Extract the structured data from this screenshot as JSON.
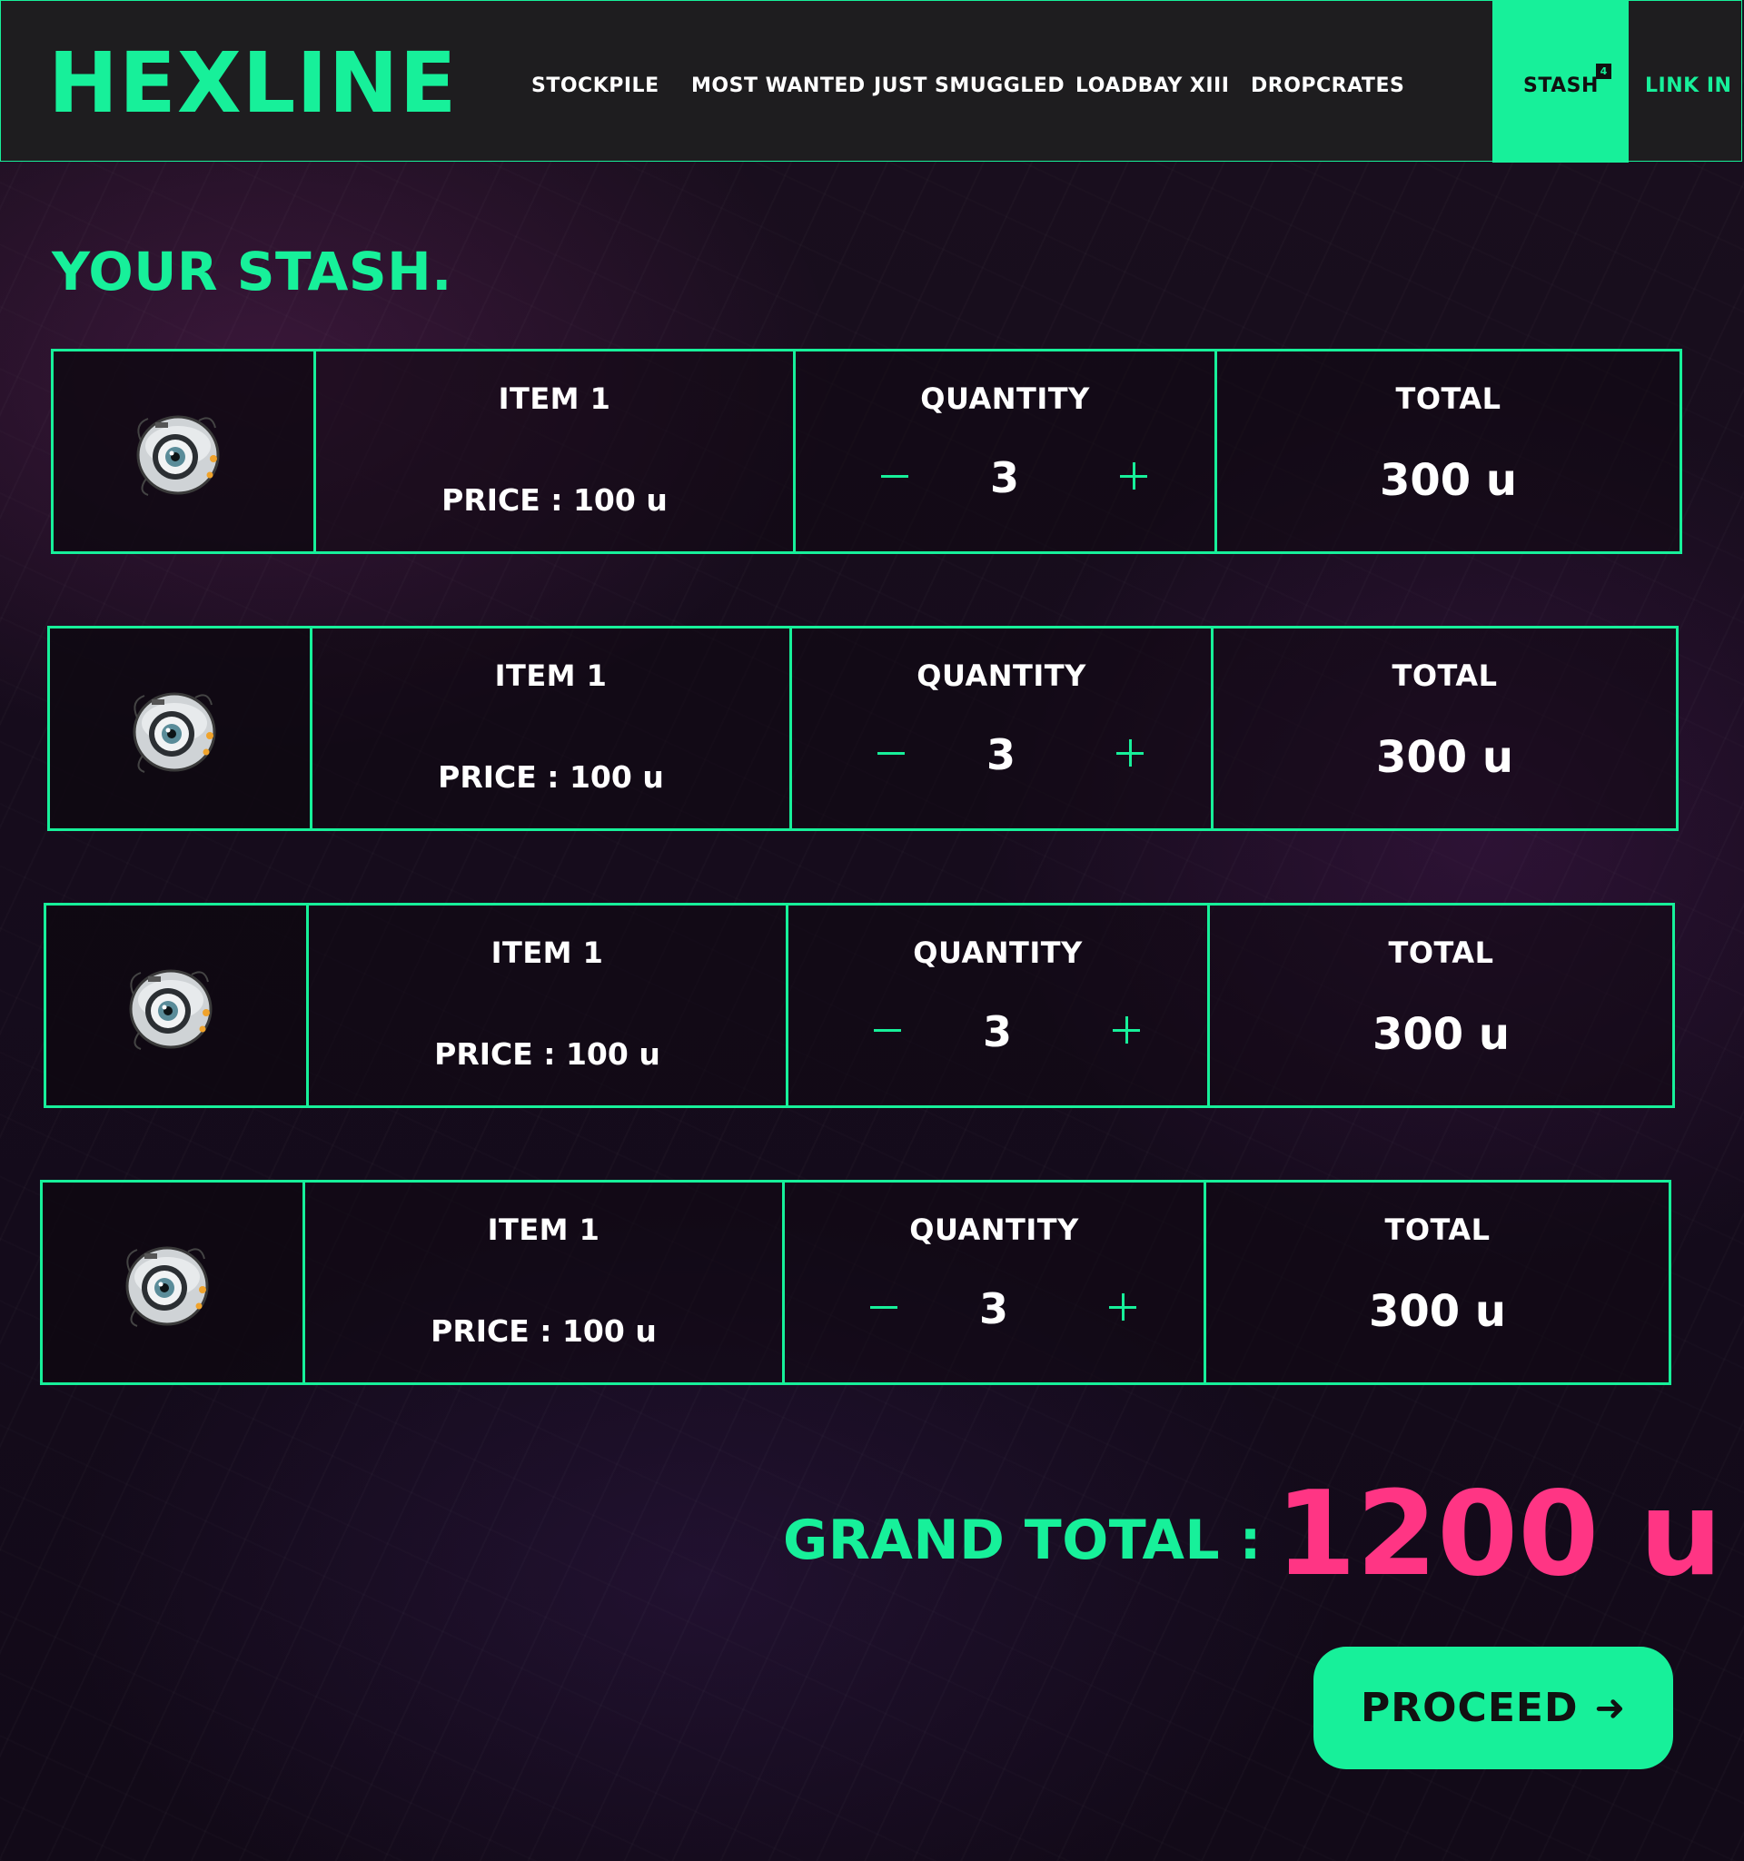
{
  "brand": {
    "logo": "HEXLINE"
  },
  "nav": {
    "links": [
      "STOCKPILE",
      "MOST WANTED",
      "JUST SMUGGLED",
      "LOADBAY XIII",
      "DROPCRATES"
    ],
    "stash_label": "STASH",
    "stash_count": "4",
    "login_label": "LINK IN"
  },
  "page": {
    "title": "YOUR STASH."
  },
  "cart": {
    "headers": {
      "quantity": "QUANTITY",
      "total": "TOTAL"
    },
    "items": [
      {
        "name": "ITEM 1",
        "price": "PRICE : 100 u",
        "quantity": "3",
        "total": "300 u",
        "icon": "robot-eye-drone"
      },
      {
        "name": "ITEM 1",
        "price": "PRICE : 100 u",
        "quantity": "3",
        "total": "300 u",
        "icon": "robot-eye-drone"
      },
      {
        "name": "ITEM 1",
        "price": "PRICE : 100 u",
        "quantity": "3",
        "total": "300 u",
        "icon": "robot-eye-drone"
      },
      {
        "name": "ITEM 1",
        "price": "PRICE : 100 u",
        "quantity": "3",
        "total": "300 u",
        "icon": "robot-eye-drone"
      }
    ]
  },
  "summary": {
    "grand_total_label": "GRAND TOTAL :",
    "grand_total_value": "1200 u"
  },
  "actions": {
    "proceed_label": "PROCEED",
    "proceed_icon": "arrow-right"
  },
  "colors": {
    "accent": "#17f09a",
    "highlight": "#ff3584",
    "navbar_bg": "#1e1d1f",
    "page_bg": "#160c1c"
  }
}
